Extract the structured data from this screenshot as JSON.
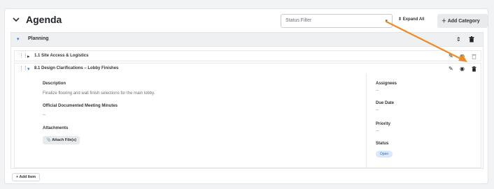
{
  "header": {
    "title": "Agenda",
    "status_filter_placeholder": "Status Filter",
    "expand_all_label": "Expand All",
    "add_category_label": "Add Category"
  },
  "category": {
    "name": "Planning"
  },
  "items": [
    {
      "label": "1.1 Site Access & Logistics"
    },
    {
      "label": "8.1 Design Clarifications – Lobby Finishes"
    }
  ],
  "detail": {
    "description_label": "Description",
    "description_text": "Finalize flooring and wall finish selections for the main lobby.",
    "minutes_label": "Official Documented Meeting Minutes",
    "minutes_value": "--",
    "attachments_label": "Attachments",
    "attach_button_label": "Attach File(s)",
    "assignees_label": "Assignees",
    "assignees_value": "--",
    "due_date_label": "Due Date",
    "due_date_value": "--",
    "priority_label": "Priority",
    "priority_value": "--",
    "status_label": "Status",
    "status_value": "Open"
  },
  "footer": {
    "add_item_label": "Add Item"
  },
  "colors": {
    "accent": "#2e7bd6",
    "annotation_arrow": "#f08a24",
    "status_pill_bg": "#dbe8fb"
  },
  "icons": [
    "chevron-down-icon",
    "caret-down-icon",
    "sort-icon",
    "plus-icon",
    "trash-icon",
    "drag-handle-icon",
    "triangle-right-icon",
    "triangle-down-icon",
    "pencil-icon",
    "eye-icon",
    "paperclip-icon"
  ]
}
